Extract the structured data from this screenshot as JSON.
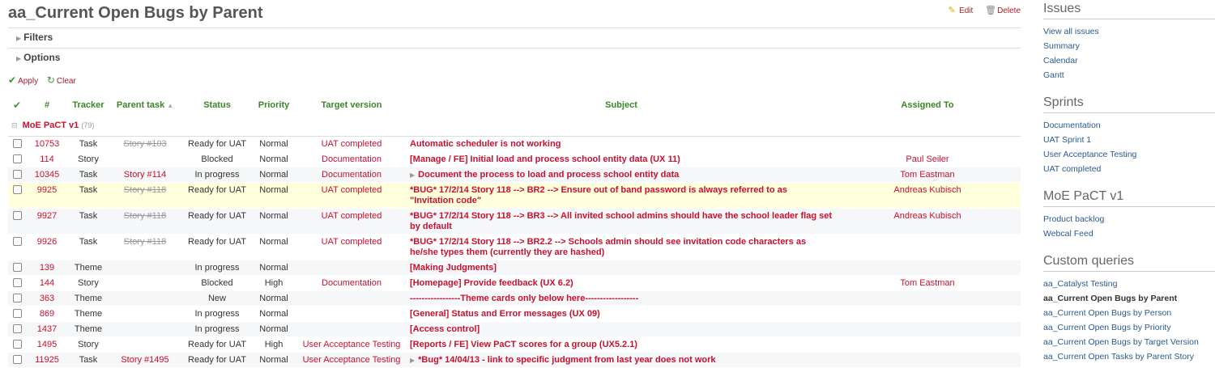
{
  "page": {
    "title": "aa_Current Open Bugs by Parent",
    "edit_label": "Edit",
    "delete_label": "Delete"
  },
  "filters": {
    "filters_label": "Filters",
    "options_label": "Options"
  },
  "buttons": {
    "apply_label": "Apply",
    "clear_label": "Clear"
  },
  "table": {
    "headers": {
      "id": "#",
      "tracker": "Tracker",
      "parent": "Parent task",
      "status": "Status",
      "priority": "Priority",
      "target_version": "Target version",
      "subject": "Subject",
      "assigned_to": "Assigned To"
    },
    "group": {
      "name": "MoE PaCT v1",
      "count": "(79)"
    },
    "rows": [
      {
        "id": "10753",
        "tracker": "Task",
        "parent": "Story #103",
        "parent_closed": true,
        "status": "Ready for UAT",
        "priority": "Normal",
        "version": "UAT completed",
        "subject": "Automatic scheduler is not working",
        "subtask": false,
        "assigned": "",
        "style": "odd"
      },
      {
        "id": "114",
        "tracker": "Story",
        "parent": "",
        "parent_closed": false,
        "status": "Blocked",
        "priority": "Normal",
        "version": "Documentation",
        "subject": "[Manage / FE] Initial load and process school entity data (UX 11)",
        "subtask": false,
        "assigned": "Paul Seiler",
        "style": "odd"
      },
      {
        "id": "10345",
        "tracker": "Task",
        "parent": "Story #114",
        "parent_closed": false,
        "status": "In progress",
        "priority": "Normal",
        "version": "Documentation",
        "subject": "Document the process to load and process school entity data",
        "subtask": true,
        "assigned": "Tom Eastman",
        "style": "even"
      },
      {
        "id": "9925",
        "tracker": "Task",
        "parent": "Story #118",
        "parent_closed": true,
        "status": "Ready for UAT",
        "priority": "Normal",
        "version": "UAT completed",
        "subject": "*BUG* 17/2/14 Story 118 --> BR2 --> Ensure out of band password is always referred to as \"Invitation code\"",
        "subtask": false,
        "assigned": "Andreas Kubisch",
        "style": "hl"
      },
      {
        "id": "9927",
        "tracker": "Task",
        "parent": "Story #118",
        "parent_closed": true,
        "status": "Ready for UAT",
        "priority": "Normal",
        "version": "UAT completed",
        "subject": "*BUG* 17/2/14 Story 118 --> BR3 --> All invited school admins should have the school leader flag set by default",
        "subtask": false,
        "assigned": "Andreas Kubisch",
        "style": "even"
      },
      {
        "id": "9926",
        "tracker": "Task",
        "parent": "Story #118",
        "parent_closed": true,
        "status": "Ready for UAT",
        "priority": "Normal",
        "version": "UAT completed",
        "subject": "*BUG* 17/2/14 Story 118 --> BR2.2 --> Schools admin should see invitation code characters as he/she types them (currently they are hashed)",
        "subtask": false,
        "assigned": "",
        "style": "odd"
      },
      {
        "id": "139",
        "tracker": "Theme",
        "parent": "",
        "parent_closed": false,
        "status": "In progress",
        "priority": "Normal",
        "version": "",
        "subject": "[Making Judgments]",
        "subtask": false,
        "assigned": "",
        "style": "even"
      },
      {
        "id": "144",
        "tracker": "Story",
        "parent": "",
        "parent_closed": false,
        "status": "Blocked",
        "priority": "High",
        "version": "Documentation",
        "subject": "[Homepage] Provide feedback (UX 6.2)",
        "subtask": false,
        "assigned": "Tom Eastman",
        "style": "odd"
      },
      {
        "id": "363",
        "tracker": "Theme",
        "parent": "",
        "parent_closed": false,
        "status": "New",
        "priority": "Normal",
        "version": "",
        "subject": "-----------------Theme cards only below here------------------",
        "subtask": false,
        "assigned": "",
        "style": "even"
      },
      {
        "id": "869",
        "tracker": "Theme",
        "parent": "",
        "parent_closed": false,
        "status": "In progress",
        "priority": "Normal",
        "version": "",
        "subject": "[General] Status and Error messages (UX 09)",
        "subtask": false,
        "assigned": "",
        "style": "odd"
      },
      {
        "id": "1437",
        "tracker": "Theme",
        "parent": "",
        "parent_closed": false,
        "status": "In progress",
        "priority": "Normal",
        "version": "",
        "subject": "[Access control]",
        "subtask": false,
        "assigned": "",
        "style": "even"
      },
      {
        "id": "1495",
        "tracker": "Story",
        "parent": "",
        "parent_closed": false,
        "status": "Ready for UAT",
        "priority": "High",
        "version": "User Acceptance Testing",
        "subject": "[Reports / FE] View PaCT scores for a group (UX5.2.1)",
        "subtask": false,
        "assigned": "",
        "style": "odd"
      },
      {
        "id": "11925",
        "tracker": "Task",
        "parent": "Story #1495",
        "parent_closed": false,
        "status": "Ready for UAT",
        "priority": "Normal",
        "version": "User Acceptance Testing",
        "subject": "*Bug* 14/04/13 - link to specific judgment from last year does not work",
        "subtask": true,
        "assigned": "",
        "style": "even"
      }
    ]
  },
  "sidebar": {
    "issues": {
      "title": "Issues",
      "items": [
        "View all issues",
        "Summary",
        "Calendar",
        "Gantt"
      ]
    },
    "sprints": {
      "title": "Sprints",
      "items": [
        "Documentation",
        "UAT Sprint 1",
        "User Acceptance Testing",
        "UAT completed"
      ]
    },
    "project": {
      "title": "MoE PaCT v1",
      "items": [
        "Product backlog",
        "Webcal Feed"
      ]
    },
    "queries": {
      "title": "Custom queries",
      "items": [
        "aa_Catalyst Testing",
        "aa_Current Open Bugs by Parent",
        "aa_Current Open Bugs by Person",
        "aa_Current Open Bugs by Priority",
        "aa_Current Open Bugs by Target Version",
        "aa_Current Open Tasks by Parent Story"
      ],
      "selected": 1
    }
  }
}
